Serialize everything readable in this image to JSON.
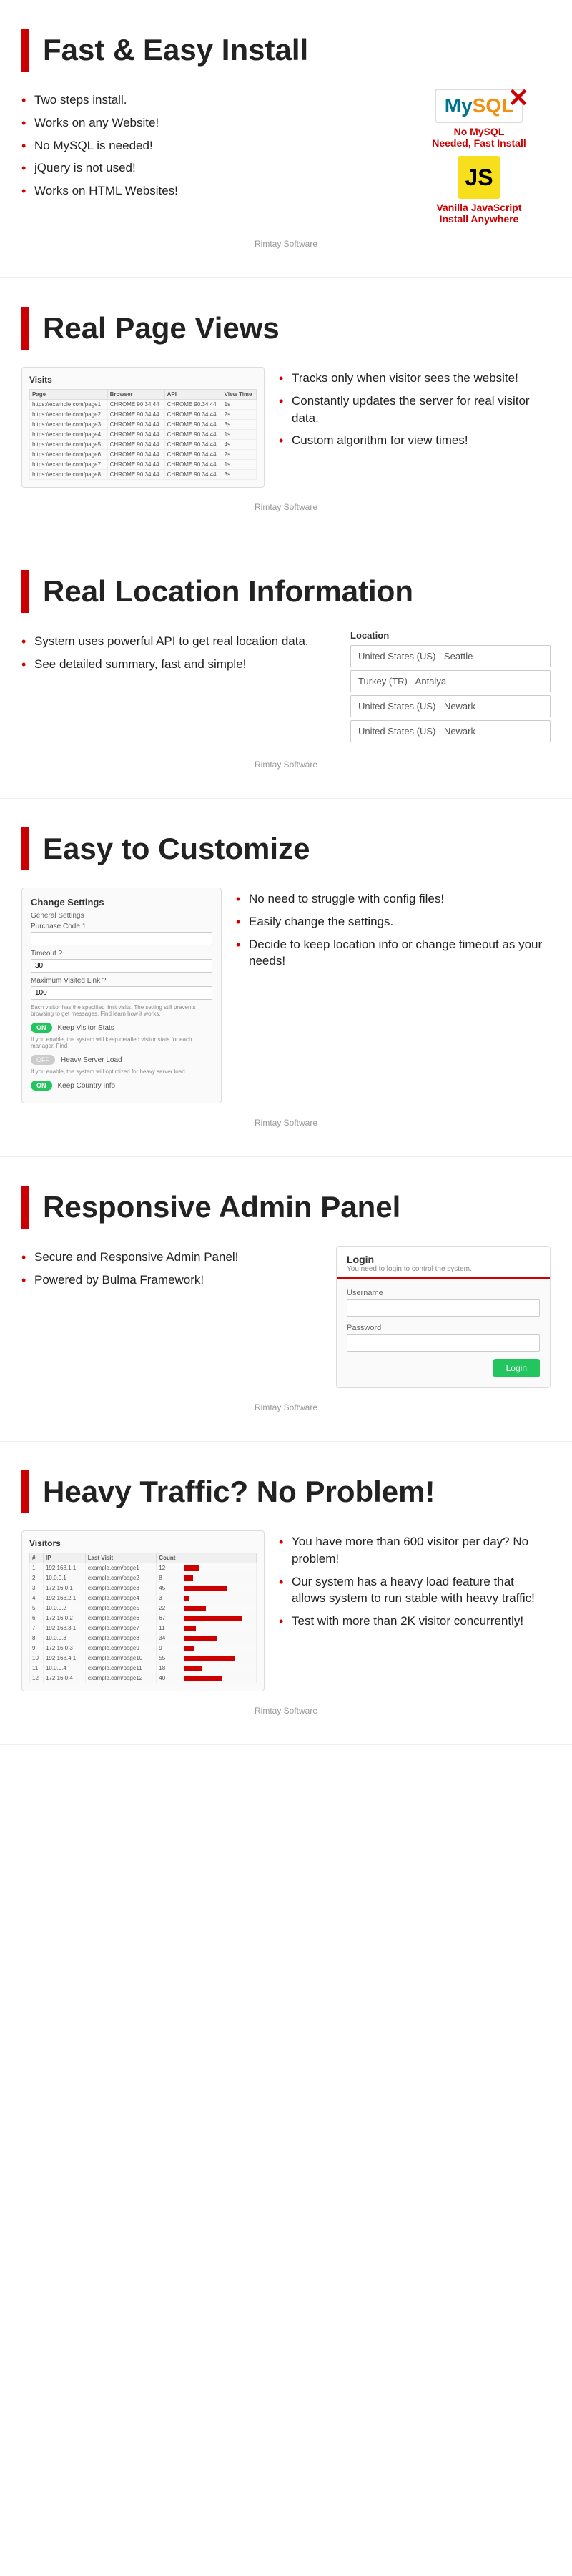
{
  "sections": [
    {
      "id": "fast-install",
      "title": "Fast & Easy Install",
      "bullets": [
        "Two steps install.",
        "Works on any Website!",
        "No MySQL is needed!",
        "jQuery is not used!",
        "Works on HTML Websites!"
      ],
      "mysql_badge": "MySQL",
      "mysql_label_line1": "No MySQL",
      "mysql_label_line2": "Needed, Fast Install",
      "js_badge": "JS",
      "js_label_line1": "Vanilla JavaScript",
      "js_label_line2": "Install Anywhere",
      "credit": "Rimtay Software"
    },
    {
      "id": "real-page-views",
      "title": "Real Page Views",
      "table_title": "Visits",
      "table_headers": [
        "Page",
        "Browser",
        "API",
        "View Time"
      ],
      "table_rows": [
        [
          "https://example.com/page1",
          "CHROME 90.34.44",
          "CHROME 90.34.44",
          "1s"
        ],
        [
          "https://example.com/page2",
          "CHROME 90.34.44",
          "CHROME 90.34.44",
          "2s"
        ],
        [
          "https://example.com/page3",
          "CHROME 90.34.44",
          "CHROME 90.34.44",
          "3s"
        ],
        [
          "https://example.com/page4",
          "CHROME 90.34.44",
          "CHROME 90.34.44",
          "1s"
        ],
        [
          "https://example.com/page5",
          "CHROME 90.34.44",
          "CHROME 90.34.44",
          "4s"
        ],
        [
          "https://example.com/page6",
          "CHROME 90.34.44",
          "CHROME 90.34.44",
          "2s"
        ],
        [
          "https://example.com/page7",
          "CHROME 90.34.44",
          "CHROME 90.34.44",
          "1s"
        ],
        [
          "https://example.com/page8",
          "CHROME 90.34.44",
          "CHROME 90.34.44",
          "3s"
        ]
      ],
      "bullets": [
        "Tracks only when visitor sees the website!",
        "Constantly updates the server for real visitor data.",
        "Custom algorithm for view times!"
      ],
      "credit": "Rimtay Software"
    },
    {
      "id": "real-location",
      "title": "Real Location Information",
      "bullets": [
        "System uses powerful API to get real location data.",
        "See detailed summary, fast and simple!"
      ],
      "location_label": "Location",
      "locations": [
        "United States (US) - Seattle",
        "Turkey (TR) - Antalya",
        "United States (US) - Newark",
        "United States (US) - Newark"
      ],
      "credit": "Rimtay Software"
    },
    {
      "id": "easy-customize",
      "title": "Easy to Customize",
      "settings_title": "Change Settings",
      "settings_section": "General Settings",
      "field1_label": "Purchase Code 1",
      "field1_value": "",
      "field2_label": "Timeout ?",
      "field2_value": "30",
      "field3_label": "Maximum Visited Link ?",
      "field3_value": "100",
      "field3_desc": "Each visitor has the specified limit visits. The setting still prevents browsing to get messages. Find learn how it works.",
      "toggle1_label": "Keep Visitor Stats",
      "toggle1_desc": "If you enable, the system will keep detailed visitor stats for each manager. Find",
      "toggle1_state": "on",
      "toggle2_label": "Heavy Server Load",
      "toggle2_desc": "If you enable, the system will optimized for heavy server load.",
      "toggle2_state": "off",
      "toggle3_label": "Keep Country Info",
      "toggle3_state": "on",
      "bullets": [
        "No need to struggle with config files!",
        "Easily change the settings.",
        "Decide to keep location info or change timeout as your needs!"
      ],
      "credit": "Rimtay Software"
    },
    {
      "id": "responsive-admin",
      "title": "Responsive Admin Panel",
      "bullets": [
        "Secure and Responsive Admin Panel!",
        "Powered by Bulma Framework!"
      ],
      "login_title": "Login",
      "login_subtitle": "You need to login to control the system.",
      "username_label": "Username",
      "password_label": "Password",
      "login_btn": "Login",
      "credit": "Rimtay Software"
    },
    {
      "id": "heavy-traffic",
      "title": "Heavy Traffic? No Problem!",
      "visitors_title": "Visitors",
      "visitors_headers": [
        "#",
        "IP",
        "Last Visit",
        "Count"
      ],
      "visitors_rows": [
        [
          "1",
          "192.168.1.1",
          "example.com/page1",
          "12"
        ],
        [
          "2",
          "10.0.0.1",
          "example.com/page2",
          "8"
        ],
        [
          "3",
          "172.16.0.1",
          "example.com/page3",
          "45"
        ],
        [
          "4",
          "192.168.2.1",
          "example.com/page4",
          "3"
        ],
        [
          "5",
          "10.0.0.2",
          "example.com/page5",
          "22"
        ],
        [
          "6",
          "172.16.0.2",
          "example.com/page6",
          "67"
        ],
        [
          "7",
          "192.168.3.1",
          "example.com/page7",
          "11"
        ],
        [
          "8",
          "10.0.0.3",
          "example.com/page8",
          "34"
        ],
        [
          "9",
          "172.16.0.3",
          "example.com/page9",
          "9"
        ],
        [
          "10",
          "192.168.4.1",
          "example.com/page10",
          "55"
        ],
        [
          "11",
          "10.0.0.4",
          "example.com/page11",
          "18"
        ],
        [
          "12",
          "172.16.0.4",
          "example.com/page12",
          "40"
        ]
      ],
      "bar_widths": [
        20,
        12,
        60,
        6,
        30,
        80,
        16,
        45,
        14,
        70,
        24,
        52
      ],
      "bullets": [
        "You have more than 600 visitor per day? No problem!",
        "Our system has a heavy load feature that allows system to run stable with heavy traffic!",
        "Test with more than 2K visitor concurrently!"
      ],
      "credit": "Rimtay Software"
    }
  ]
}
